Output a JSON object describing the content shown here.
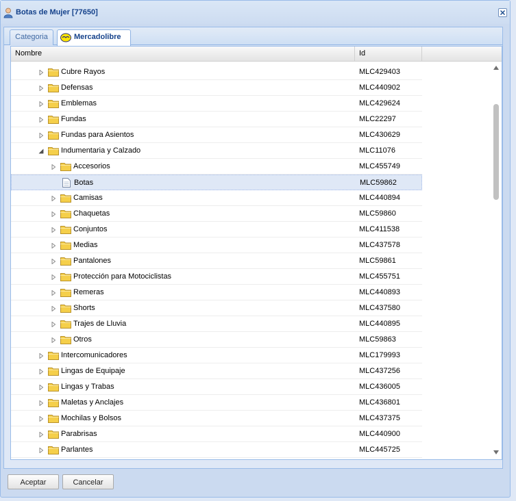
{
  "window": {
    "title": "Botas de Mujer [77650]"
  },
  "tabs": [
    {
      "label": "Categoria",
      "active": false
    },
    {
      "label": "Mercadolibre",
      "active": true
    }
  ],
  "grid": {
    "columns": [
      "Nombre",
      "Id"
    ],
    "rows": [
      {
        "label": "Cubre Rayos",
        "id": "MLC429403",
        "level": 0,
        "type": "folder",
        "state": "collapsed"
      },
      {
        "label": "Defensas",
        "id": "MLC440902",
        "level": 0,
        "type": "folder",
        "state": "collapsed"
      },
      {
        "label": "Emblemas",
        "id": "MLC429624",
        "level": 0,
        "type": "folder",
        "state": "collapsed"
      },
      {
        "label": "Fundas",
        "id": "MLC22297",
        "level": 0,
        "type": "folder",
        "state": "collapsed"
      },
      {
        "label": "Fundas para Asientos",
        "id": "MLC430629",
        "level": 0,
        "type": "folder",
        "state": "collapsed"
      },
      {
        "label": "Indumentaria y Calzado",
        "id": "MLC11076",
        "level": 0,
        "type": "folder",
        "state": "expanded"
      },
      {
        "label": "Accesorios",
        "id": "MLC455749",
        "level": 1,
        "type": "folder",
        "state": "collapsed"
      },
      {
        "label": "Botas",
        "id": "MLC59862",
        "level": 1,
        "type": "leaf",
        "state": "none",
        "selected": true
      },
      {
        "label": "Camisas",
        "id": "MLC440894",
        "level": 1,
        "type": "folder",
        "state": "collapsed"
      },
      {
        "label": "Chaquetas",
        "id": "MLC59860",
        "level": 1,
        "type": "folder",
        "state": "collapsed"
      },
      {
        "label": "Conjuntos",
        "id": "MLC411538",
        "level": 1,
        "type": "folder",
        "state": "collapsed"
      },
      {
        "label": "Medias",
        "id": "MLC437578",
        "level": 1,
        "type": "folder",
        "state": "collapsed"
      },
      {
        "label": "Pantalones",
        "id": "MLC59861",
        "level": 1,
        "type": "folder",
        "state": "collapsed"
      },
      {
        "label": "Protección para Motociclistas",
        "id": "MLC455751",
        "level": 1,
        "type": "folder",
        "state": "collapsed"
      },
      {
        "label": "Remeras",
        "id": "MLC440893",
        "level": 1,
        "type": "folder",
        "state": "collapsed"
      },
      {
        "label": "Shorts",
        "id": "MLC437580",
        "level": 1,
        "type": "folder",
        "state": "collapsed"
      },
      {
        "label": "Trajes de Lluvia",
        "id": "MLC440895",
        "level": 1,
        "type": "folder",
        "state": "collapsed"
      },
      {
        "label": "Otros",
        "id": "MLC59863",
        "level": 1,
        "type": "folder",
        "state": "collapsed"
      },
      {
        "label": "Intercomunicadores",
        "id": "MLC179993",
        "level": 0,
        "type": "folder",
        "state": "collapsed"
      },
      {
        "label": "Lingas de Equipaje",
        "id": "MLC437256",
        "level": 0,
        "type": "folder",
        "state": "collapsed"
      },
      {
        "label": "Lingas y Trabas",
        "id": "MLC436005",
        "level": 0,
        "type": "folder",
        "state": "collapsed"
      },
      {
        "label": "Maletas y Anclajes",
        "id": "MLC436801",
        "level": 0,
        "type": "folder",
        "state": "collapsed"
      },
      {
        "label": "Mochilas y Bolsos",
        "id": "MLC437375",
        "level": 0,
        "type": "folder",
        "state": "collapsed"
      },
      {
        "label": "Parabrisas",
        "id": "MLC440900",
        "level": 0,
        "type": "folder",
        "state": "collapsed"
      },
      {
        "label": "Parlantes",
        "id": "MLC445725",
        "level": 0,
        "type": "folder",
        "state": "collapsed"
      }
    ]
  },
  "buttons": {
    "accept": "Aceptar",
    "cancel": "Cancelar"
  },
  "colors": {
    "title": "#15428b",
    "folder": "#f5cf4a",
    "selection": "#dfe8f6"
  }
}
